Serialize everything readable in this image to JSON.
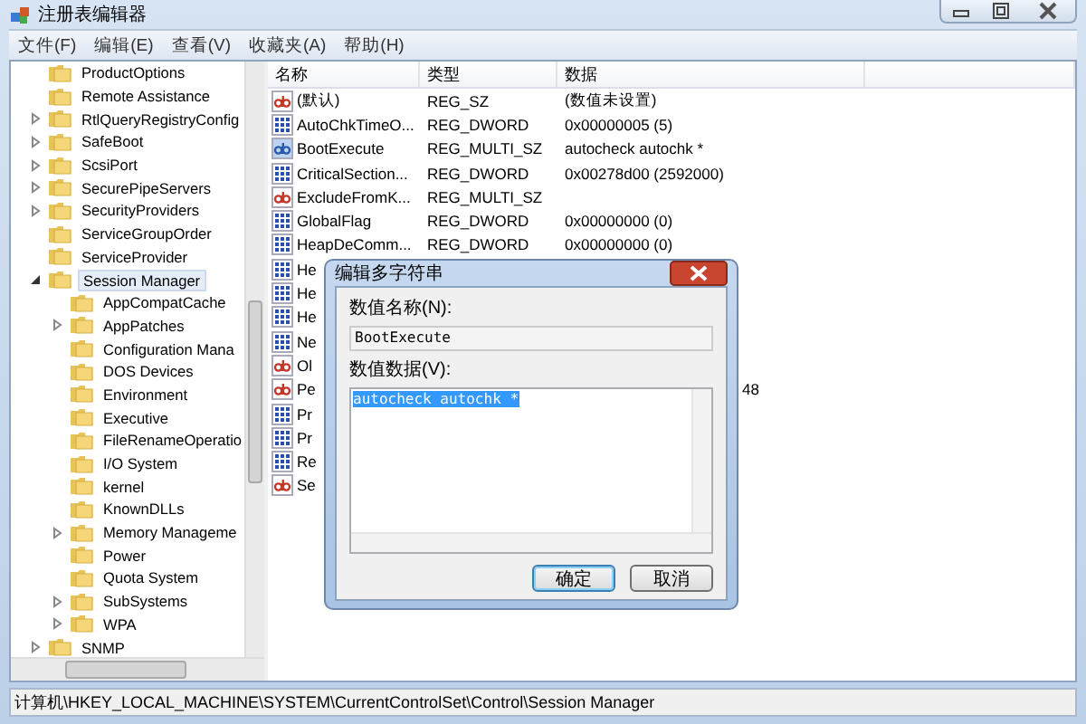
{
  "window": {
    "title": "注册表编辑器"
  },
  "menu": [
    "文件(F)",
    "编辑(E)",
    "查看(V)",
    "收藏夹(A)",
    "帮助(H)"
  ],
  "tree": [
    {
      "label": "ProductOptions",
      "expandable": false,
      "selected": false
    },
    {
      "label": "Remote Assistance",
      "expandable": false,
      "selected": false
    },
    {
      "label": "RtlQueryRegistryConfig",
      "expandable": true,
      "expanded": false,
      "selected": false
    },
    {
      "label": "SafeBoot",
      "expandable": true,
      "expanded": false,
      "selected": false
    },
    {
      "label": "ScsiPort",
      "expandable": true,
      "expanded": false,
      "selected": false
    },
    {
      "label": "SecurePipeServers",
      "expandable": true,
      "expanded": false,
      "selected": false
    },
    {
      "label": "SecurityProviders",
      "expandable": true,
      "expanded": false,
      "selected": false
    },
    {
      "label": "ServiceGroupOrder",
      "expandable": false,
      "selected": false
    },
    {
      "label": "ServiceProvider",
      "expandable": false,
      "selected": false
    },
    {
      "label": "Session Manager",
      "expandable": true,
      "expanded": true,
      "selected": true,
      "children": [
        {
          "label": "AppCompatCache",
          "expandable": false,
          "selected": false
        },
        {
          "label": "AppPatches",
          "expandable": true,
          "expanded": false,
          "selected": false
        },
        {
          "label": "Configuration Mana",
          "expandable": false,
          "selected": false
        },
        {
          "label": "DOS Devices",
          "expandable": false,
          "selected": false
        },
        {
          "label": "Environment",
          "expandable": false,
          "selected": false
        },
        {
          "label": "Executive",
          "expandable": false,
          "selected": false
        },
        {
          "label": "FileRenameOperatio",
          "expandable": false,
          "selected": false
        },
        {
          "label": "I/O System",
          "expandable": false,
          "selected": false
        },
        {
          "label": "kernel",
          "expandable": false,
          "selected": false
        },
        {
          "label": "KnownDLLs",
          "expandable": false,
          "selected": false
        },
        {
          "label": "Memory Manageme",
          "expandable": true,
          "expanded": false,
          "selected": false
        },
        {
          "label": "Power",
          "expandable": false,
          "selected": false
        },
        {
          "label": "Quota System",
          "expandable": false,
          "selected": false
        },
        {
          "label": "SubSystems",
          "expandable": true,
          "expanded": false,
          "selected": false
        },
        {
          "label": "WPA",
          "expandable": true,
          "expanded": false,
          "selected": false
        }
      ]
    },
    {
      "label": "SNMP",
      "expandable": true,
      "expanded": false,
      "selected": false
    }
  ],
  "columns": [
    "名称",
    "类型",
    "数据"
  ],
  "values": [
    {
      "kind": "string",
      "name": "(默认)",
      "type": "REG_SZ",
      "data": "(数值未设置)",
      "selected": false
    },
    {
      "kind": "dword",
      "name": "AutoChkTimeO...",
      "type": "REG_DWORD",
      "data": "0x00000005 (5)",
      "selected": false
    },
    {
      "kind": "string",
      "name": "BootExecute",
      "type": "REG_MULTI_SZ",
      "data": "autocheck autochk *",
      "selected": true
    },
    {
      "kind": "dword",
      "name": "CriticalSection...",
      "type": "REG_DWORD",
      "data": "0x00278d00 (2592000)",
      "selected": false
    },
    {
      "kind": "string",
      "name": "ExcludeFromK...",
      "type": "REG_MULTI_SZ",
      "selected": false
    },
    {
      "kind": "dword",
      "name": "GlobalFlag",
      "type": "REG_DWORD",
      "data": "0x00000000 (0)",
      "selected": false
    },
    {
      "kind": "dword",
      "name": "HeapDeComm...",
      "type": "REG_DWORD",
      "data": "0x00000000 (0)",
      "selected": false
    },
    {
      "kind": "dword",
      "name": "He",
      "selected": false
    },
    {
      "kind": "dword",
      "name": "He",
      "selected": false
    },
    {
      "kind": "dword",
      "name": "He",
      "selected": false
    },
    {
      "kind": "dword",
      "name": "Ne",
      "selected": false
    },
    {
      "kind": "string",
      "name": "Ol",
      "selected": false
    },
    {
      "kind": "string",
      "name": "Pe",
      "data_tail": "48",
      "selected": false
    },
    {
      "kind": "dword",
      "name": "Pr",
      "selected": false
    },
    {
      "kind": "dword",
      "name": "Pr",
      "selected": false
    },
    {
      "kind": "dword",
      "name": "Re",
      "selected": false
    },
    {
      "kind": "string",
      "name": "Se",
      "selected": false
    }
  ],
  "dialog": {
    "title": "编辑多字符串",
    "name_label": "数值名称(N):",
    "name_value": "BootExecute",
    "data_label": "数值数据(V):",
    "data_value": "autocheck autochk *",
    "buttons": [
      {
        "label": "确定",
        "default": true
      },
      {
        "label": "取消",
        "default": false
      }
    ]
  },
  "status_bar": "计算机\\HKEY_LOCAL_MACHINE\\SYSTEM\\CurrentControlSet\\Control\\Session Manager"
}
